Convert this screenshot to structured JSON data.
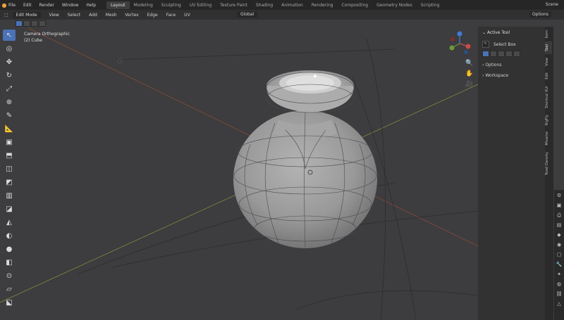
{
  "topbar": {
    "menu": [
      "File",
      "Edit",
      "Render",
      "Window",
      "Help"
    ],
    "workspaces": [
      "Layout",
      "Modeling",
      "Sculpting",
      "UV Editing",
      "Texture Paint",
      "Shading",
      "Animation",
      "Rendering",
      "Compositing",
      "Geometry Nodes",
      "Scripting"
    ],
    "active_workspace": "Layout",
    "scene_label": "Scene"
  },
  "viewport_header": {
    "mode": "Edit Mode",
    "menu": [
      "View",
      "Select",
      "Add",
      "Mesh",
      "Vertex",
      "Edge",
      "Face",
      "UV"
    ],
    "orientation": "Global",
    "options_label": "Options"
  },
  "viewport_overlay": {
    "camera": "Camera Orthographic",
    "object": "(2) Cube"
  },
  "npanel": {
    "section_title": "Active Tool",
    "tool_name": "Select Box",
    "options_label": "Options",
    "workspace_label": "Workspace"
  },
  "tabs": [
    "Item",
    "Tool",
    "View",
    "Edit",
    "Shortcut VUr",
    "RigFly",
    "Mixamo",
    "Texel Density"
  ],
  "active_tab": "Tool",
  "colors": {
    "accent": "#4b72b7",
    "bg": "#3d3c3e",
    "mesh": "#9d9c9d"
  }
}
